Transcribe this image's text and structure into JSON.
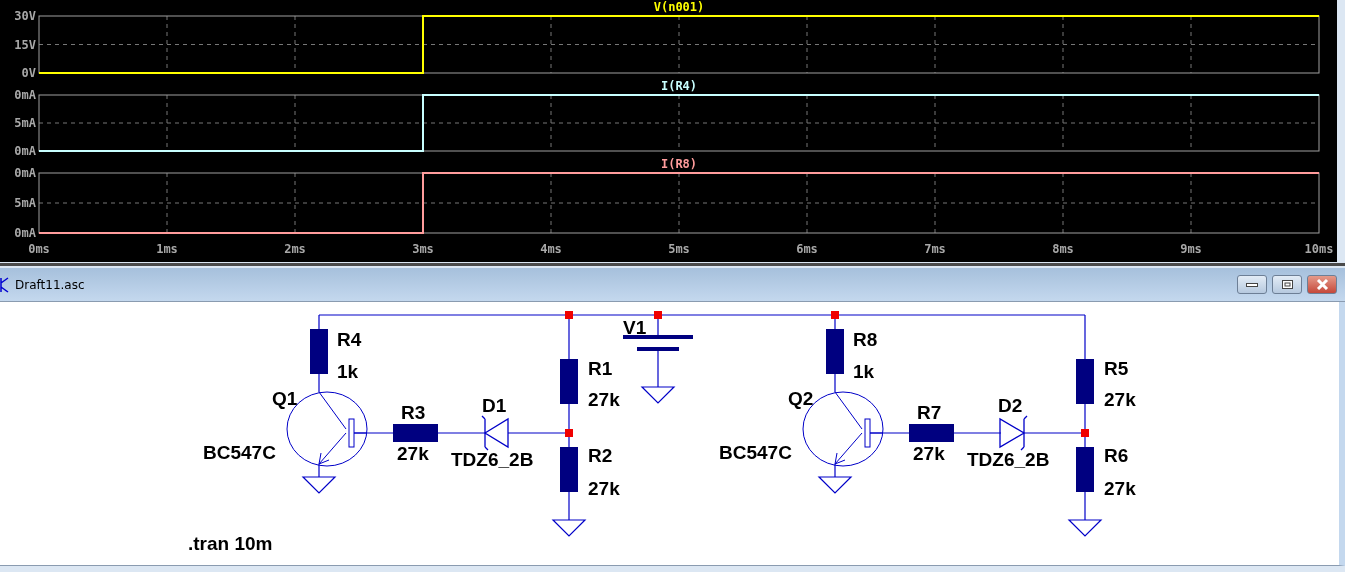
{
  "waveform_viewer": {
    "plots": [
      {
        "trace": "V(n001)",
        "color": "#ffff00",
        "axis_labels": [
          "30V",
          "15V",
          "0V"
        ]
      },
      {
        "trace": "I(R4)",
        "color": "#c8ffff",
        "axis_labels": [
          "0mA",
          "5mA",
          "0mA"
        ]
      },
      {
        "trace": "I(R8)",
        "color": "#ff9c9c",
        "axis_labels": [
          "0mA",
          "5mA",
          "0mA"
        ],
        "time_labels": [
          "0ms",
          "1ms",
          "2ms",
          "3ms",
          "4ms",
          "5ms",
          "6ms",
          "7ms",
          "8ms",
          "9ms",
          "10ms"
        ]
      }
    ]
  },
  "schematic_window": {
    "title": "Draft11.asc",
    "components": [
      {
        "kind": "resistor",
        "name": "R4",
        "value": "1k"
      },
      {
        "kind": "npn",
        "name": "Q1",
        "value": "BC547C"
      },
      {
        "kind": "resistor",
        "name": "R3",
        "value": "27k"
      },
      {
        "kind": "zener",
        "name": "D1",
        "value": "TDZ6_2B"
      },
      {
        "kind": "resistor",
        "name": "R1",
        "value": "27k"
      },
      {
        "kind": "resistor",
        "name": "R2",
        "value": "27k"
      },
      {
        "kind": "voltage_source",
        "name": "V1"
      },
      {
        "kind": "resistor",
        "name": "R8",
        "value": "1k"
      },
      {
        "kind": "npn",
        "name": "Q2",
        "value": "BC547C"
      },
      {
        "kind": "resistor",
        "name": "R7",
        "value": "27k"
      },
      {
        "kind": "zener",
        "name": "D2",
        "value": "TDZ6_2B"
      },
      {
        "kind": "resistor",
        "name": "R5",
        "value": "27k"
      },
      {
        "kind": "resistor",
        "name": "R6",
        "value": "27k"
      }
    ],
    "directive": ".tran 10m"
  }
}
